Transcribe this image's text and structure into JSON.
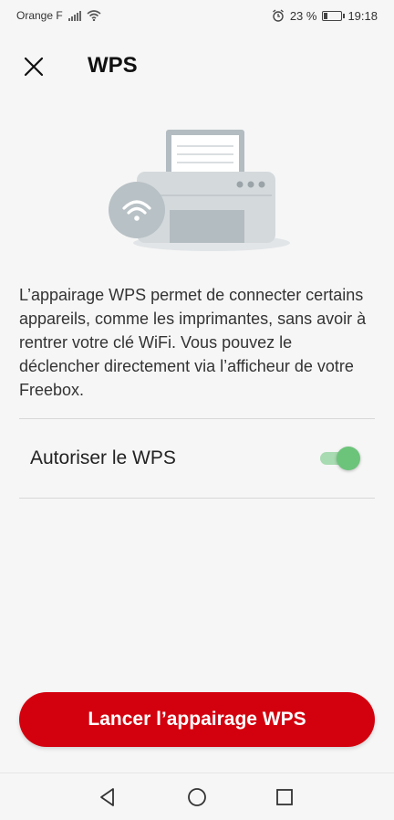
{
  "status_bar": {
    "carrier": "Orange F",
    "battery_percent": "23 %",
    "battery_level": 0.23,
    "time": "19:18"
  },
  "header": {
    "title": "WPS",
    "close_icon": "close-icon"
  },
  "illustration": {
    "icons": [
      "printer-icon",
      "wifi-icon"
    ]
  },
  "description": "L’appairage WPS permet de connecter certains appareils, comme les imprimantes, sans avoir à rentrer votre clé WiFi. Vous pouvez le déclencher directement via l’afficheur de votre Freebox.",
  "wps_toggle": {
    "label": "Autoriser le WPS",
    "enabled": true
  },
  "launch_button": {
    "label": "Lancer l’appairage WPS"
  },
  "nav_bar": {
    "icons": [
      "back-icon",
      "home-icon",
      "recents-icon"
    ]
  },
  "colors": {
    "accent": "#d3000e",
    "toggle_on": "#6cc47a",
    "background": "#f6f6f6"
  }
}
